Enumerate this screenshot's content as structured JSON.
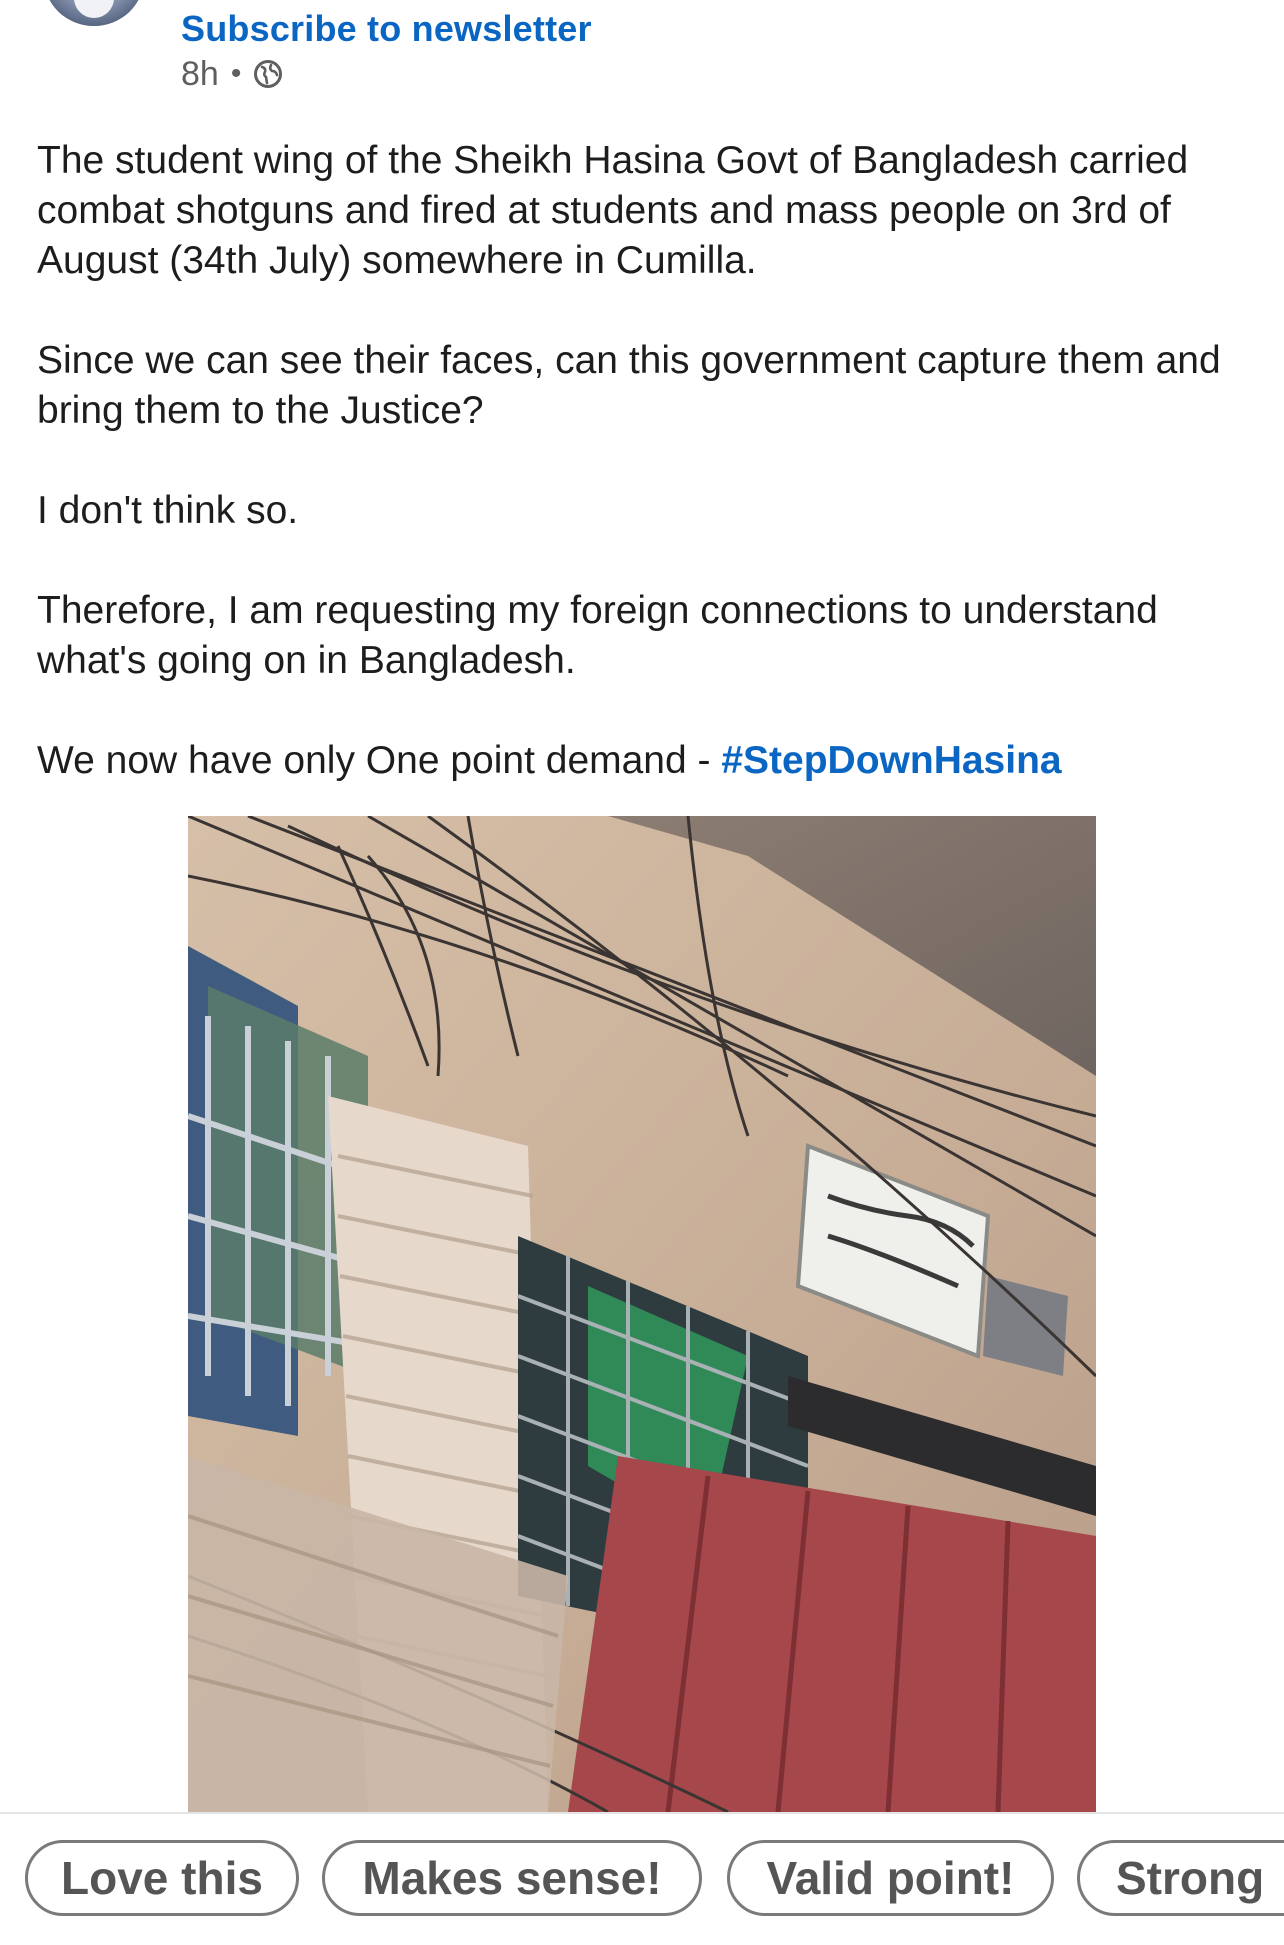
{
  "post": {
    "subscribe_label": "Subscribe to newsletter",
    "time": "8h",
    "separator": "•",
    "visibility_icon": "globe-icon",
    "paragraphs": [
      "The student wing of the Sheikh Hasina Govt of Bangladesh carried combat shotguns and fired at students and mass people on 3rd of August (34th July) somewhere in Cumilla.",
      "Since we can see their faces, can this government capture them and bring them to the Justice?",
      "I don't think so.",
      "Therefore, I am requesting my foreign connections to understand what's going on in Bangladesh."
    ],
    "demand_text": "We now have only One point demand - ",
    "hashtag": "#StepDownHasina"
  },
  "reactions": {
    "chips": [
      "Love this",
      "Makes sense!",
      "Valid point!",
      "Strong"
    ]
  },
  "colors": {
    "link_blue": "#0a66c2",
    "chip_border": "#7a7a7a",
    "meta_gray": "#5f5f5f"
  }
}
